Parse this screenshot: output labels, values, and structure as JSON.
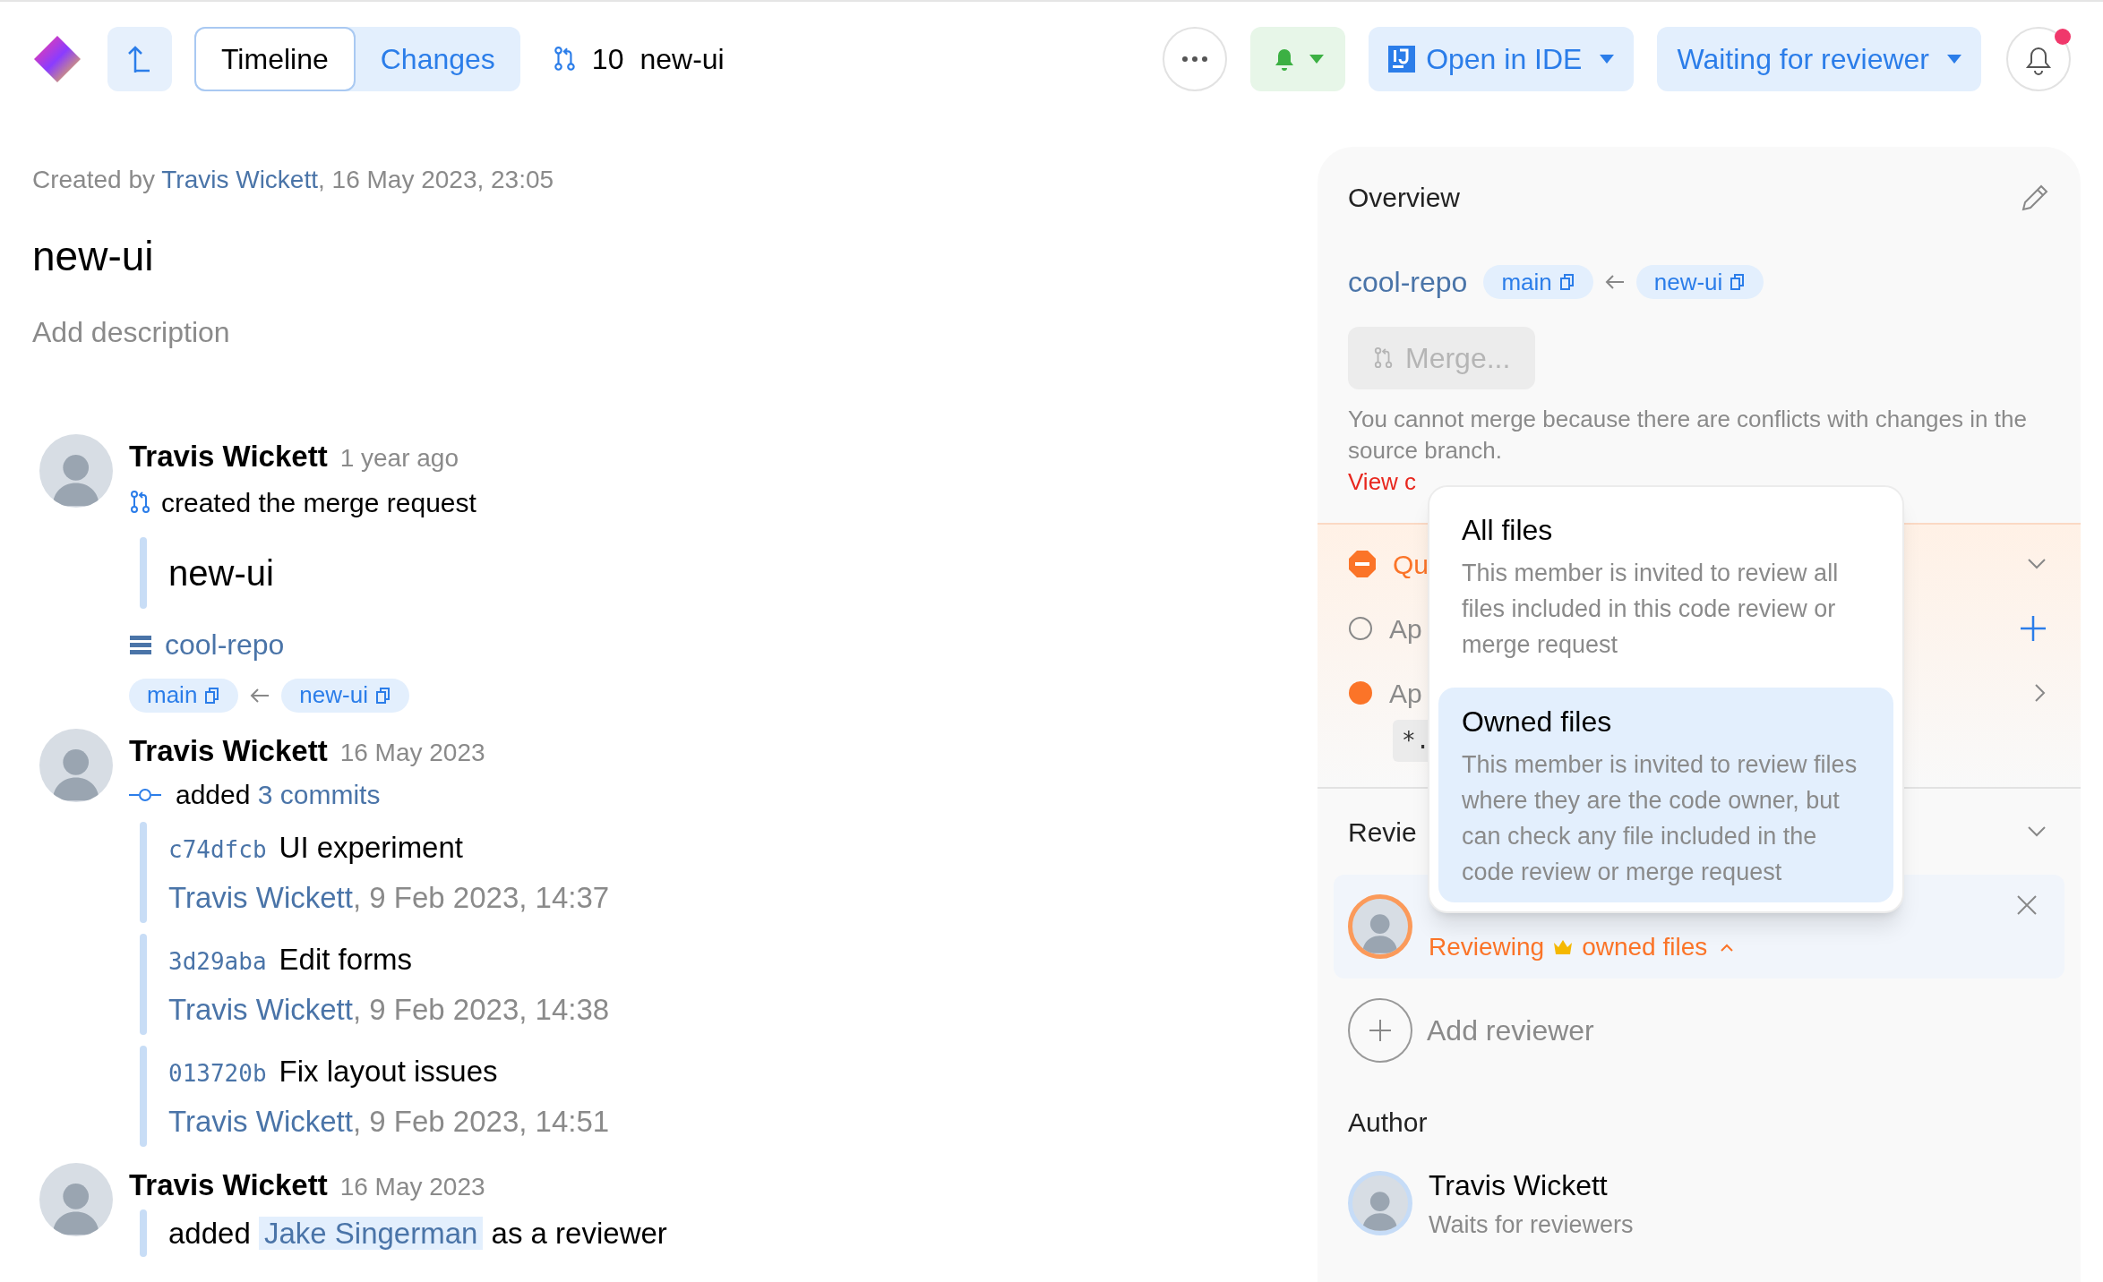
{
  "toolbar": {
    "tabs": [
      {
        "label": "Timeline",
        "selected": true
      },
      {
        "label": "Changes",
        "selected": false
      }
    ],
    "mr_number": "10",
    "mr_branch": "new-ui",
    "ide_button": "Open in IDE",
    "status_button": "Waiting for reviewer",
    "unread_notifications": true
  },
  "header": {
    "created_prefix": "Created by",
    "author": "Travis Wickett",
    "created_suffix": ", 16 May 2023, 23:05",
    "title": "new-ui",
    "description_placeholder": "Add description"
  },
  "timeline": [
    {
      "kind": "created",
      "author": "Travis Wickett",
      "time": "1 year ago",
      "action": "created the merge request",
      "title": "new-ui",
      "repo": "cool-repo",
      "target_branch": "main",
      "source_branch": "new-ui"
    },
    {
      "kind": "commits",
      "author": "Travis Wickett",
      "time": "16 May 2023",
      "action": "added",
      "link": "3 commits",
      "commits": [
        {
          "hash": "c74dfcb",
          "message": "UI experiment",
          "author": "Travis Wickett",
          "date": ", 9 Feb 2023, 14:37"
        },
        {
          "hash": "3d29aba",
          "message": "Edit forms",
          "author": "Travis Wickett",
          "date": ", 9 Feb 2023, 14:38"
        },
        {
          "hash": "013720b",
          "message": "Fix layout issues",
          "author": "Travis Wickett",
          "date": ", 9 Feb 2023, 14:51"
        }
      ]
    },
    {
      "kind": "reviewer",
      "author": "Travis Wickett",
      "time": "16 May 2023",
      "action": "added",
      "reviewer": "Jake Singerman",
      "suffix": "as a reviewer"
    }
  ],
  "overview": {
    "title": "Overview",
    "repo": "cool-repo",
    "target_branch": "main",
    "source_branch": "new-ui",
    "merge_button": {
      "label": "Merge...",
      "disabled": true
    },
    "merge_message": "You cannot merge because there are conflicts with changes in the source branch.",
    "conflicts_link": "View c"
  },
  "checks": [
    {
      "kind": "blocked",
      "label": "Qu"
    },
    {
      "kind": "pending",
      "label": "Ap"
    },
    {
      "kind": "in_progress",
      "label": "Ap",
      "pattern": "*."
    }
  ],
  "reviewers": {
    "title": "Revie",
    "items": [
      {
        "status": "Reviewing",
        "scope": "owned files",
        "expanded": true
      }
    ],
    "add_label": "Add reviewer"
  },
  "author_section": {
    "title": "Author",
    "name": "Travis Wickett",
    "status": "Waits for reviewers"
  },
  "scope_menu": {
    "options": [
      {
        "title": "All files",
        "description": "This member is invited to review all files included in this code review or merge request",
        "selected": false
      },
      {
        "title": "Owned files",
        "description": "This member is invited to review files where they are the code owner, but can check any file included in the code review or merge request",
        "selected": true
      }
    ]
  }
}
